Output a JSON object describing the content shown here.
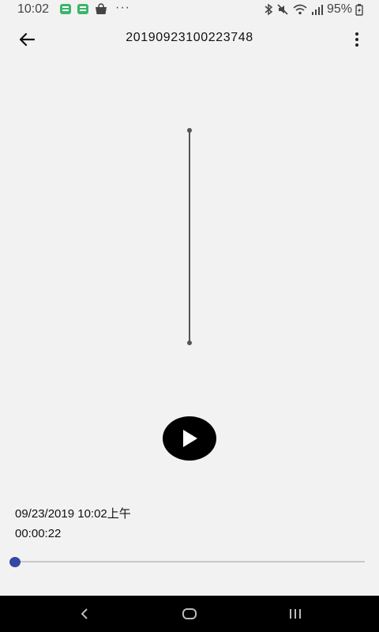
{
  "status_bar": {
    "time": "10:02",
    "more": "···",
    "battery": "95%",
    "icons": [
      "notification-app-icon",
      "notification-app-icon",
      "shopping-bag-icon",
      "bluetooth-icon",
      "mute-icon",
      "wifi-icon",
      "signal-icon",
      "battery-charging-icon"
    ]
  },
  "app_bar": {
    "title": "20190923100223748",
    "back_icon": "arrow-left-icon",
    "menu_icon": "more-vert-icon"
  },
  "recording": {
    "date": "09/23/2019 10:02上午",
    "duration": "00:00:22",
    "progress": 0.0
  },
  "player": {
    "play_icon": "play-icon"
  },
  "nav_bar": {
    "icons": [
      "nav-back-icon",
      "nav-home-icon",
      "nav-recents-icon"
    ]
  },
  "colors": {
    "background": "#f2f2f2",
    "accent": "#3447a4",
    "nav_bar": "#000000"
  }
}
